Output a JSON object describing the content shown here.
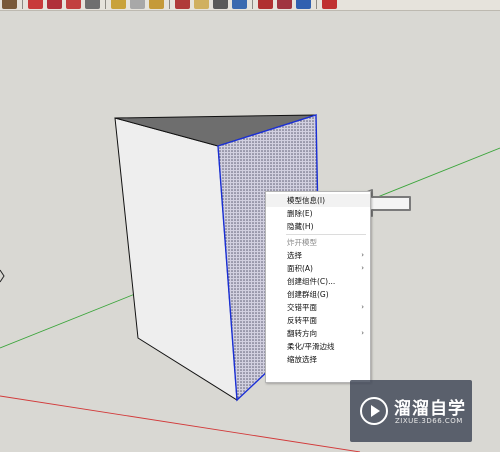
{
  "context_menu": {
    "items": [
      {
        "label": "模型信息(I)",
        "enabled": true,
        "submenu": false
      },
      {
        "label": "删除(E)",
        "enabled": true,
        "submenu": false
      },
      {
        "label": "隐藏(H)",
        "enabled": true,
        "submenu": false
      },
      {
        "label": "炸开模型",
        "enabled": false,
        "submenu": false
      },
      {
        "label": "选择",
        "enabled": true,
        "submenu": true
      },
      {
        "label": "面积(A)",
        "enabled": true,
        "submenu": true
      },
      {
        "label": "创建组件(C)...",
        "enabled": true,
        "submenu": false
      },
      {
        "label": "创建群组(G)",
        "enabled": true,
        "submenu": false
      },
      {
        "label": "交错平面",
        "enabled": true,
        "submenu": true
      },
      {
        "label": "反转平面",
        "enabled": true,
        "submenu": false
      },
      {
        "label": "翻转方向",
        "enabled": true,
        "submenu": true
      },
      {
        "label": "柔化/平滑边线",
        "enabled": true,
        "submenu": false
      },
      {
        "label": "缩放选择",
        "enabled": true,
        "submenu": false
      }
    ],
    "submenu_glyph": "›"
  },
  "watermark": {
    "title": "溜溜自学",
    "url": "ZIXUE.3D66.COM",
    "icon": "play-circle-icon"
  },
  "colors": {
    "background": "#d9d8d3",
    "selection_edge": "#1a2fd6",
    "green_axis": "#3aa53a",
    "red_axis": "#d23a3a",
    "watermark_bg": "#3e4656"
  },
  "icons": {
    "annotation_arrow": "left-arrow-outline-icon",
    "toolbar": [
      "paint-bucket-icon",
      "eraser-icon",
      "move-icon",
      "rotate-icon",
      "scale-icon",
      "tape-icon",
      "orbit-icon",
      "pan-icon",
      "zoom-icon",
      "walk-icon",
      "section-icon",
      "export-icon",
      "warehouse-icon"
    ]
  }
}
